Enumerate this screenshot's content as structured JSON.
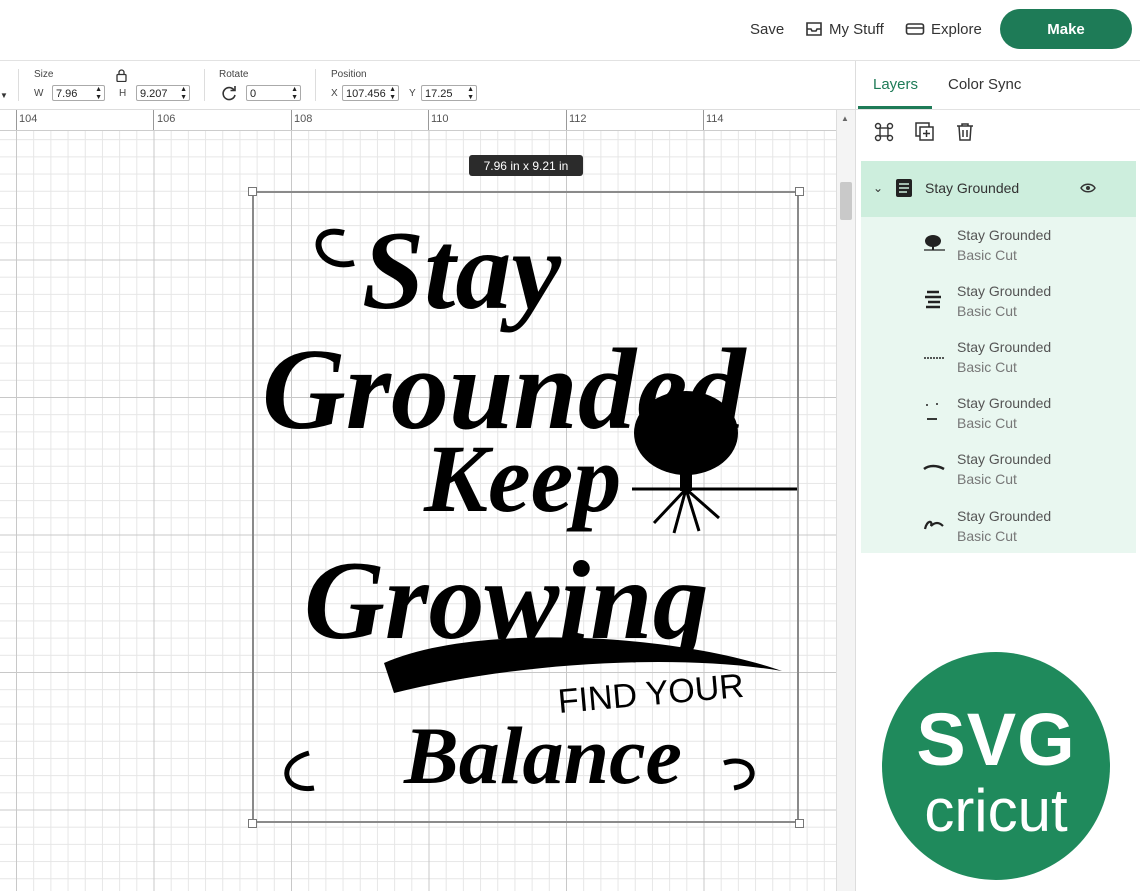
{
  "topbar": {
    "save_label": "Save",
    "mystuff_label": "My Stuff",
    "explore_label": "Explore",
    "make_label": "Make"
  },
  "toolbar": {
    "size_label": "Size",
    "w_label": "W",
    "w_value": "7.96",
    "h_label": "H",
    "h_value": "9.207",
    "rotate_label": "Rotate",
    "rotate_value": "0",
    "position_label": "Position",
    "x_label": "X",
    "x_value": "107.456",
    "y_label": "Y",
    "y_value": "17.25"
  },
  "ruler": {
    "labels": [
      "104",
      "106",
      "108",
      "110",
      "112",
      "114"
    ]
  },
  "canvas": {
    "size_tooltip": "7.96  in x 9.21  in",
    "artwork": {
      "line1": "Stay",
      "line2": "Grounded",
      "line3": "Keep",
      "line4": "Growing",
      "line5": "FIND YOUR",
      "line6": "Balance"
    }
  },
  "panel": {
    "tabs": [
      {
        "label": "Layers",
        "active": true
      },
      {
        "label": "Color Sync",
        "active": false
      }
    ],
    "group": {
      "name": "Stay Grounded",
      "layers": [
        {
          "name": "Stay Grounded",
          "type": "Basic Cut",
          "thumb": "tree-icon"
        },
        {
          "name": "Stay Grounded",
          "type": "Basic Cut",
          "thumb": "design-icon"
        },
        {
          "name": "Stay Grounded",
          "type": "Basic Cut",
          "thumb": "find-your-icon"
        },
        {
          "name": "Stay Grounded",
          "type": "Basic Cut",
          "thumb": "dots-icon"
        },
        {
          "name": "Stay Grounded",
          "type": "Basic Cut",
          "thumb": "balance-icon"
        },
        {
          "name": "Stay Grounded",
          "type": "Basic Cut",
          "thumb": "stay-icon"
        }
      ]
    }
  },
  "badge": {
    "line1": "SVG",
    "line2": "cricut"
  },
  "colors": {
    "accent": "#1e7b57",
    "group_bg": "#e9f7f0",
    "group_head_bg": "#cdeedd",
    "badge": "#1f8a5c"
  }
}
